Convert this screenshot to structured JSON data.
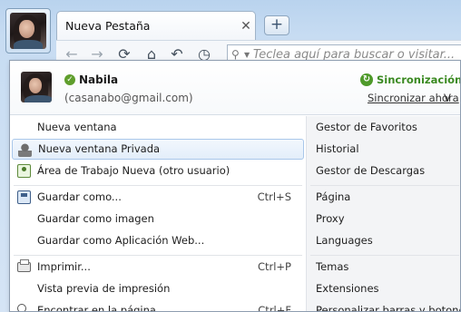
{
  "chrome": {
    "tab_title": "Nueva Pestaña",
    "tab_close": "✕",
    "new_tab": "+",
    "search_placeholder": "Teclea aquí para buscar o visitar..."
  },
  "profile": {
    "name": "Nabila",
    "email": "(casanabo@gmail.com)",
    "sync_status": "Sincronización co",
    "sync_now": "Sincronizar ahora",
    "more": "V"
  },
  "menu_left": [
    {
      "label": "Nueva ventana",
      "shortcut": ""
    },
    {
      "label": "Nueva ventana Privada",
      "shortcut": ""
    },
    {
      "label": "Área de Trabajo Nueva (otro usuario)",
      "shortcut": ""
    },
    {
      "label": "Guardar como...",
      "shortcut": "Ctrl+S"
    },
    {
      "label": "Guardar como imagen",
      "shortcut": ""
    },
    {
      "label": "Guardar como Aplicación Web...",
      "shortcut": ""
    },
    {
      "label": "Imprimir...",
      "shortcut": "Ctrl+P"
    },
    {
      "label": "Vista previa de impresión",
      "shortcut": ""
    },
    {
      "label": "Encontrar en la página",
      "shortcut": "Ctrl+F"
    }
  ],
  "menu_right": [
    {
      "label": "Gestor de Favoritos"
    },
    {
      "label": "Historial"
    },
    {
      "label": "Gestor de Descargas"
    },
    {
      "label": "Página"
    },
    {
      "label": "Proxy"
    },
    {
      "label": "Languages"
    },
    {
      "label": "Temas"
    },
    {
      "label": "Extensiones"
    },
    {
      "label": "Personalizar barras y botones"
    }
  ],
  "colors": {
    "accent_green": "#3b8a22",
    "highlight_border": "#a9c7ea"
  }
}
